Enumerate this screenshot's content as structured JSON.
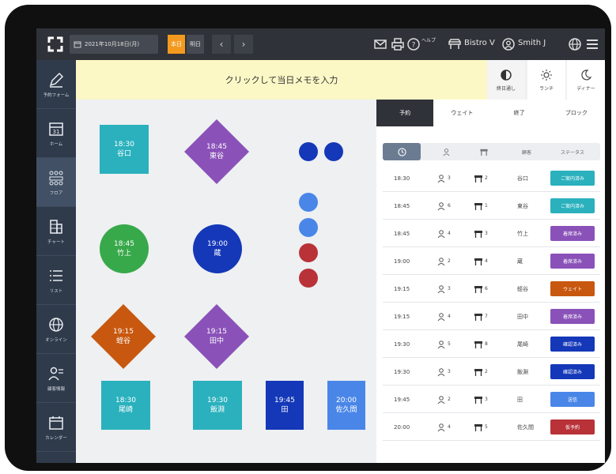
{
  "header": {
    "date": "2021年10月18日(月)",
    "today_label": "本日",
    "tomorrow_label": "明日",
    "prev_icon": "chevron-left",
    "next_icon": "chevron-right",
    "help_label": "ヘルプ",
    "store_name": "Bistro V",
    "user_name": "Smith J"
  },
  "sidebar": {
    "items": [
      {
        "label": "予約フォーム",
        "icon": "pencil-icon"
      },
      {
        "label": "ホーム",
        "icon": "calendar-home-icon"
      },
      {
        "label": "フロア",
        "icon": "floor-icon"
      },
      {
        "label": "チャート",
        "icon": "chart-icon"
      },
      {
        "label": "リスト",
        "icon": "list-icon"
      },
      {
        "label": "オンライン",
        "icon": "globe-icon"
      },
      {
        "label": "顧客情報",
        "icon": "customer-icon"
      },
      {
        "label": "カレンダー",
        "icon": "calendar-icon"
      }
    ]
  },
  "memo": {
    "placeholder": "クリックして当日メモを入力"
  },
  "services": [
    {
      "label": "終日通し",
      "icon": "half-circle-icon"
    },
    {
      "label": "ランチ",
      "icon": "sun-icon"
    },
    {
      "label": "ディナー",
      "icon": "moon-icon"
    }
  ],
  "floor": {
    "tables": [
      {
        "time": "18:30",
        "name": "谷口",
        "color": "#2ab1bd"
      },
      {
        "time": "18:45",
        "name": "東谷",
        "color": "#8a52b8"
      },
      {
        "time": "18:45",
        "name": "竹上",
        "color": "#38a94a"
      },
      {
        "time": "19:00",
        "name": "蔵",
        "color": "#1438b8"
      },
      {
        "time": "19:15",
        "name": "蛭谷",
        "color": "#c8580f"
      },
      {
        "time": "19:15",
        "name": "田中",
        "color": "#8a52b8"
      },
      {
        "time": "18:30",
        "name": "尾崎",
        "color": "#2ab1bd"
      },
      {
        "time": "19:30",
        "name": "飯淵",
        "color": "#2ab1bd"
      },
      {
        "time": "19:45",
        "name": "田",
        "color": "#1438b8"
      },
      {
        "time": "20:00",
        "name": "佐久間",
        "color": "#4a86e8"
      }
    ],
    "dot_colors": [
      "#1438b8",
      "#1438b8",
      "#4a86e8",
      "#4a86e8",
      "#b83238",
      "#b83238"
    ]
  },
  "panel": {
    "tabs": [
      "予約",
      "ウェイト",
      "終了",
      "ブロック"
    ],
    "columns": {
      "name": "顧客",
      "status": "ステータス"
    },
    "rows": [
      {
        "time": "18:30",
        "guests": "3",
        "table": "2",
        "name": "谷口",
        "status": "ご案内済み",
        "color": "#2ab1bd"
      },
      {
        "time": "18:45",
        "guests": "6",
        "table": "1",
        "name": "東谷",
        "status": "ご案内済み",
        "color": "#2ab1bd"
      },
      {
        "time": "18:45",
        "guests": "4",
        "table": "3",
        "name": "竹上",
        "status": "着席済み",
        "color": "#8a52b8"
      },
      {
        "time": "19:00",
        "guests": "2",
        "table": "4",
        "name": "蔵",
        "status": "着席済み",
        "color": "#8a52b8"
      },
      {
        "time": "19:15",
        "guests": "3",
        "table": "6",
        "name": "蛭谷",
        "status": "ウェイト",
        "color": "#c8580f"
      },
      {
        "time": "19:15",
        "guests": "4",
        "table": "7",
        "name": "田中",
        "status": "着席済み",
        "color": "#8a52b8"
      },
      {
        "time": "19:30",
        "guests": "5",
        "table": "8",
        "name": "尾崎",
        "status": "確認済み",
        "color": "#1438b8"
      },
      {
        "time": "19:30",
        "guests": "3",
        "table": "2",
        "name": "飯淵",
        "status": "確認済み",
        "color": "#1438b8"
      },
      {
        "time": "19:45",
        "guests": "2",
        "table": "3",
        "name": "田",
        "status": "送信",
        "color": "#4a86e8"
      },
      {
        "time": "20:00",
        "guests": "4",
        "table": "5",
        "name": "佐久間",
        "status": "仮予約",
        "color": "#b83238"
      }
    ]
  }
}
